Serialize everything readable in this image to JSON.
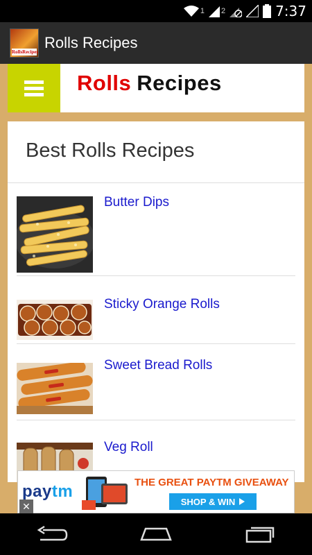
{
  "status_bar": {
    "time": "7:37",
    "sim1": "1",
    "sim2": "2",
    "icons": [
      "wifi-icon",
      "signal-icon",
      "signal-icon",
      "data-icon",
      "signal-icon",
      "battery-icon"
    ]
  },
  "action_bar": {
    "title": "Rolls Recipes",
    "icon_label": "RollsRecipes"
  },
  "header": {
    "logo_part1": "Rolls",
    "logo_part2": "Recipes",
    "menu_icon": "hamburger-menu-icon"
  },
  "card": {
    "title": "Best Rolls Recipes",
    "items": [
      {
        "title": "Butter Dips",
        "thumb": "butter-dips-photo"
      },
      {
        "title": "Sticky Orange Rolls",
        "thumb": "sticky-orange-rolls-photo"
      },
      {
        "title": "Sweet Bread Rolls",
        "thumb": "sweet-bread-rolls-photo"
      },
      {
        "title": "Veg Roll",
        "thumb": "veg-roll-photo"
      }
    ]
  },
  "ad": {
    "brand_part1": "pay",
    "brand_part2": "tm",
    "headline": "THE GREAT PAYTM GIVEAWAY",
    "cta": "SHOP & WIN",
    "close": "✕"
  },
  "nav_bar": {
    "icons": [
      "back-icon",
      "home-icon",
      "recent-apps-icon"
    ]
  },
  "colors": {
    "background": "#d8ad6a",
    "menu_button": "#c8d400",
    "link": "#1a1acd",
    "logo_red": "#e00000"
  }
}
